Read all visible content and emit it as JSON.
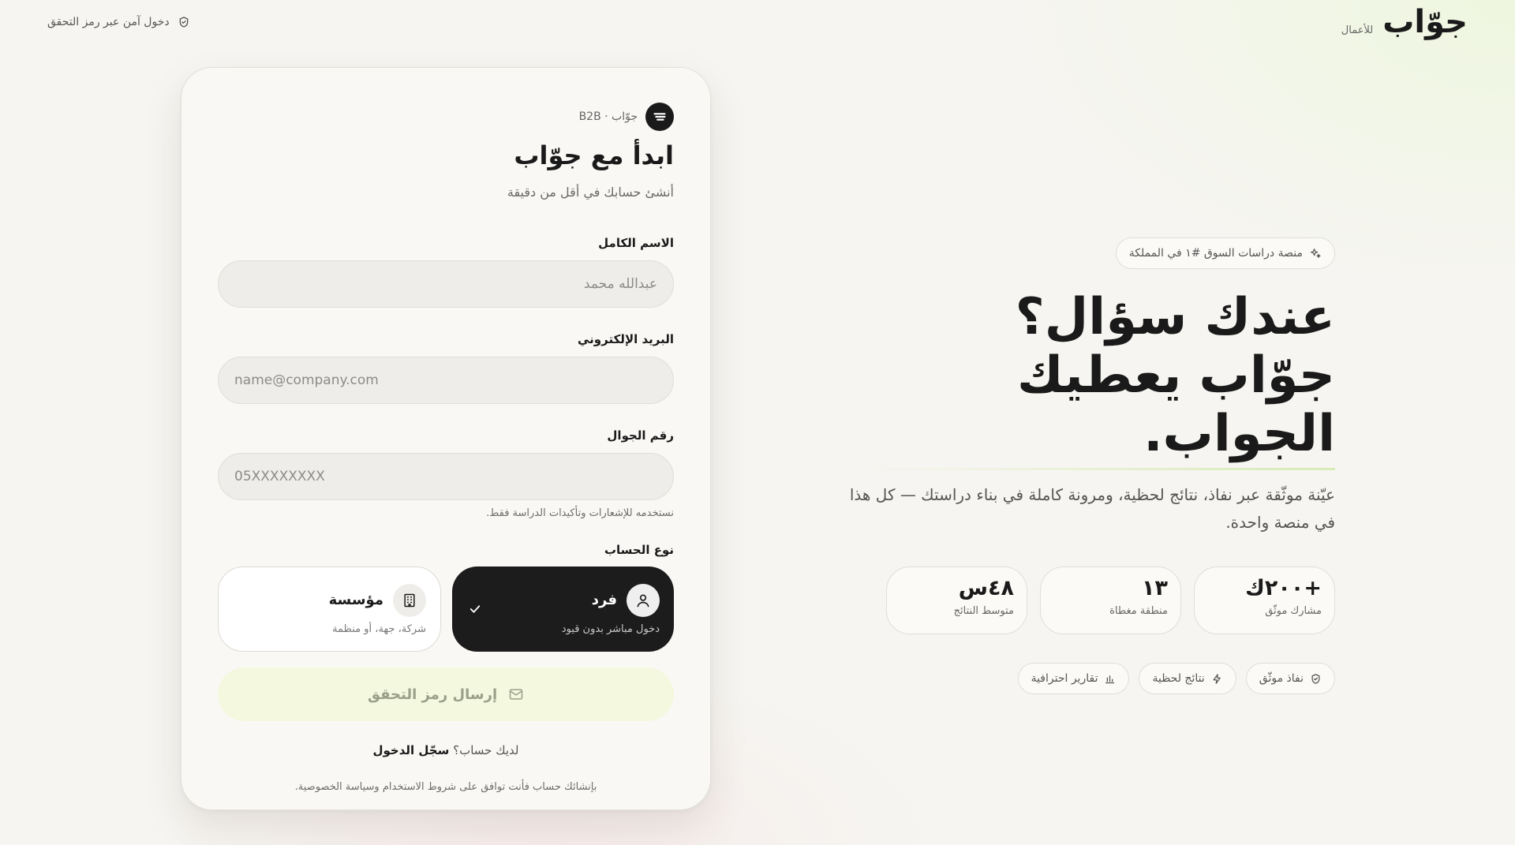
{
  "header": {
    "brand_logo": "جوّاب",
    "brand_subtitle": "للأعمال",
    "secure_login": "دخول آمن عبر رمز التحقق"
  },
  "card": {
    "tag": "جوّاب · B2B",
    "title": "ابدأ مع جوّاب",
    "subtitle": "أنشئ حسابك في أقل من دقيقة",
    "name_label": "الاسم الكامل",
    "name_placeholder": "عبدالله محمد",
    "email_label": "البريد الإلكتروني",
    "email_placeholder": "name@company.com",
    "phone_label": "رقم الجوال",
    "phone_placeholder": "05XXXXXXXX",
    "phone_hint": "نستخدمه للإشعارات وتأكيدات الدراسة فقط.",
    "account_type_label": "نوع الحساب",
    "account_types": [
      {
        "title": "فرد",
        "desc": "دخول مباشر بدون قيود",
        "icon": "user-icon",
        "selected": true
      },
      {
        "title": "مؤسسة",
        "desc": "شركة، جهة، أو منظمة",
        "icon": "building-icon",
        "selected": false
      }
    ],
    "send_button": "إرسال رمز التحقق",
    "have_account": "لديك حساب؟",
    "login_link": "سجّل الدخول",
    "terms": "بإنشائك حساب فأنت توافق على شروط الاستخدام وسياسة الخصوصية."
  },
  "hero": {
    "badge": "منصة دراسات السوق #١ في المملكة",
    "headline_line1": "عندك سؤال؟",
    "headline_line2": "جوّاب يعطيك الجواب.",
    "description": "عيّنة موثّقة عبر نفاذ، نتائج لحظية، ومرونة كاملة في بناء دراستك — كل هذا في منصة واحدة.",
    "stats": [
      {
        "value": "+٢٠٠ك",
        "label": "مشارك موثّق"
      },
      {
        "value": "١٣",
        "label": "منطقة مغطاة"
      },
      {
        "value": "٤٨س",
        "label": "متوسط النتائج"
      }
    ],
    "chips": [
      {
        "label": "نفاذ موثّق",
        "icon": "shield-icon"
      },
      {
        "label": "نتائج لحظية",
        "icon": "lightning-icon"
      },
      {
        "label": "تقارير احترافية",
        "icon": "bar-chart-icon"
      }
    ]
  },
  "colors": {
    "primary_dark": "#1c1c1c",
    "accent_soft_green": "#f3f8df",
    "background": "#f6f5f1"
  }
}
